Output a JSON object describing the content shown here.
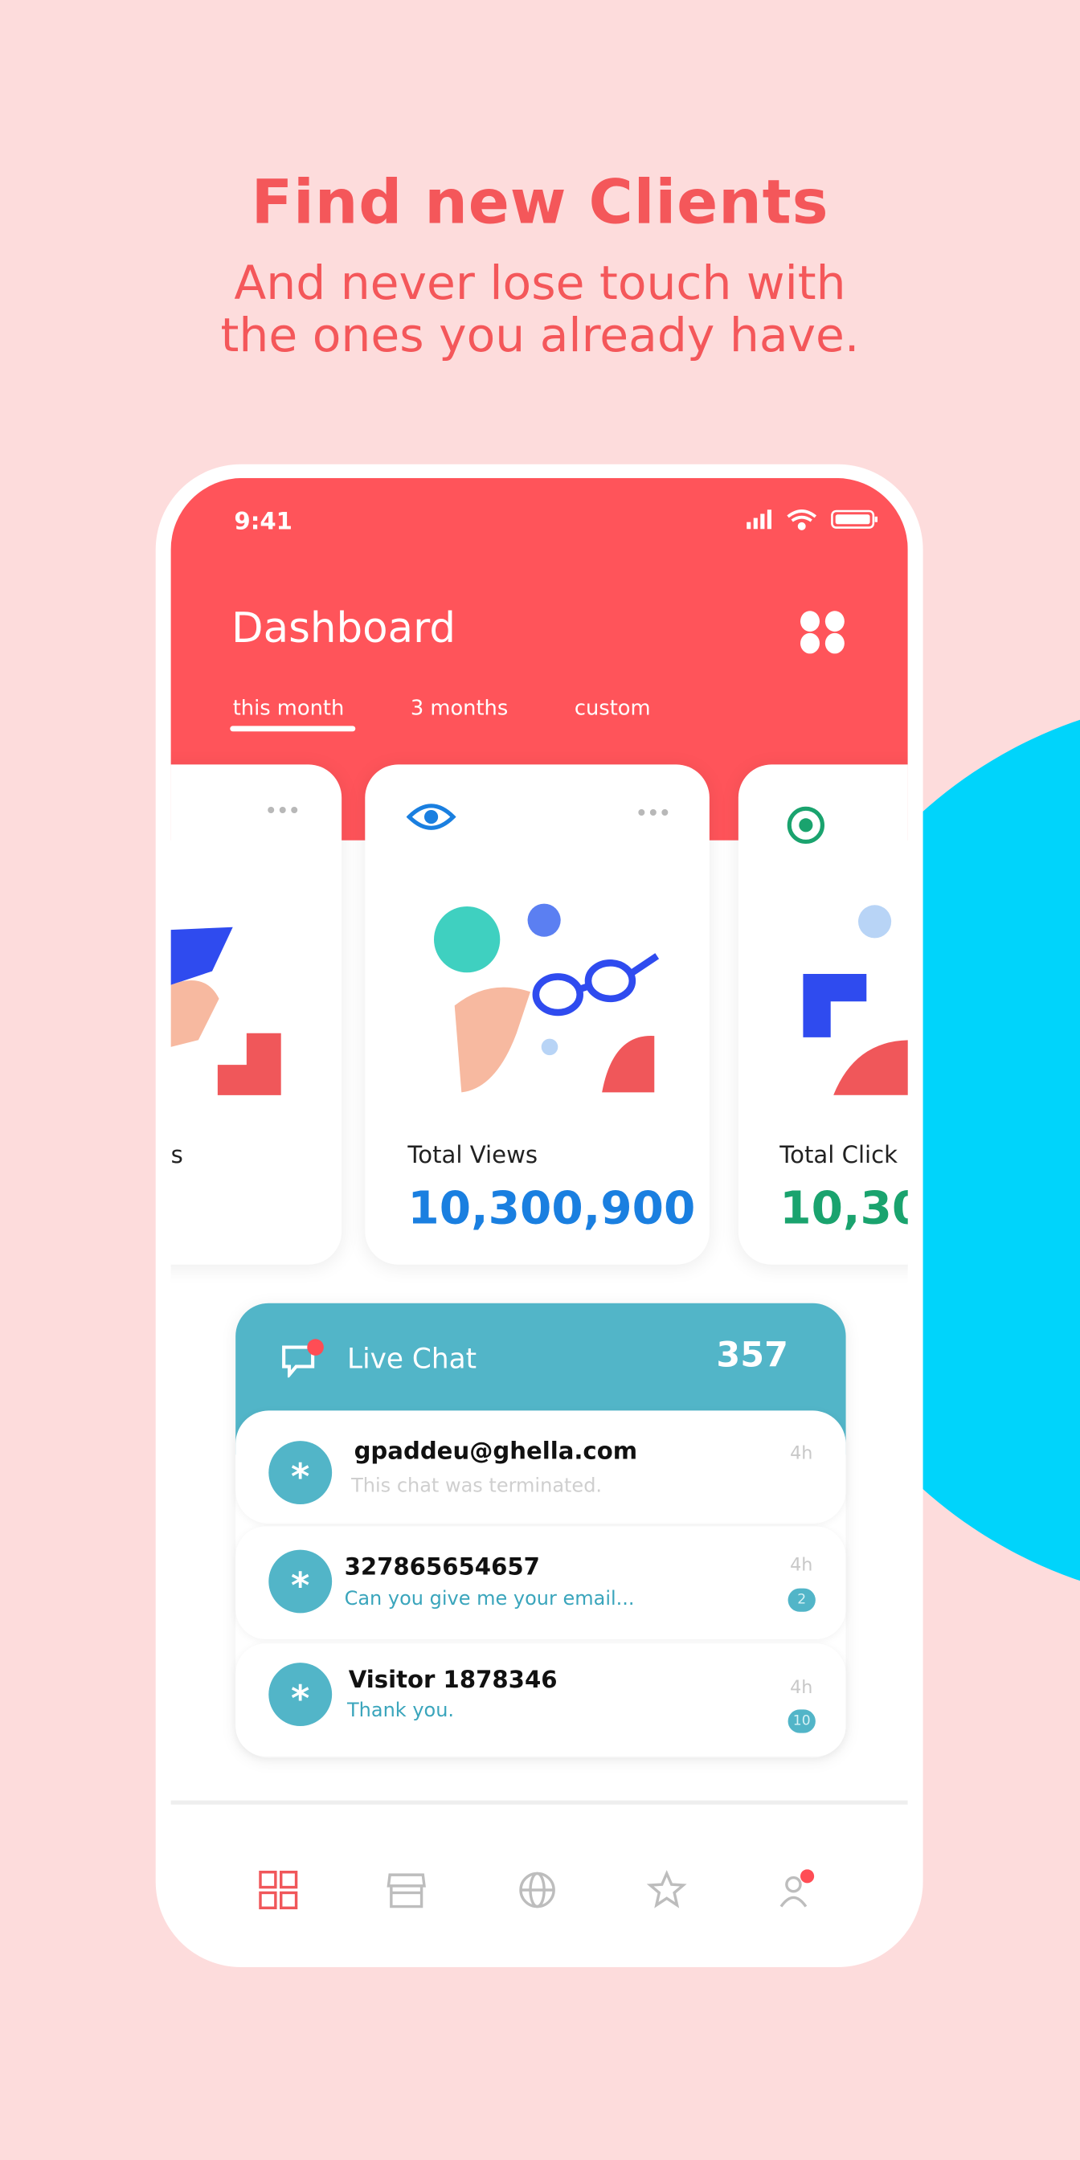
{
  "hero": {
    "title": "Find new Clients",
    "subtitle_line1": "And never lose touch with",
    "subtitle_line2": "the ones you already have."
  },
  "colors": {
    "background": "#fddcdc",
    "accent_red": "#ff545a",
    "teal": "#52b5c8",
    "cyan_blob": "#00d4fb",
    "views_blue": "#1a7fe0",
    "clicks_green": "#1aa36e"
  },
  "status_bar": {
    "time": "9:41",
    "icons": [
      "signal-icon",
      "wifi-icon",
      "battery-icon"
    ]
  },
  "header": {
    "title": "Dashboard",
    "menu_icon": "grid-dots-icon",
    "tabs": [
      {
        "label": "this month",
        "active": true
      },
      {
        "label": "3 months",
        "active": false
      },
      {
        "label": "custom",
        "active": false
      }
    ]
  },
  "cards": [
    {
      "label": "s",
      "icon": "none"
    },
    {
      "label": "Total Views",
      "value": "10,300,900",
      "icon": "eye-icon"
    },
    {
      "label": "Total Click",
      "value": "10,30",
      "icon": "target-icon"
    }
  ],
  "live_chat": {
    "title": "Live Chat",
    "count": "357",
    "chats": [
      {
        "name": "gpaddeu@ghella.com",
        "message": "This chat was terminated.",
        "time": "4h",
        "unread": null
      },
      {
        "name": "327865654657",
        "message": "Can you give me your email...",
        "time": "4h",
        "unread": "2"
      },
      {
        "name": "Visitor 1878346",
        "message": "Thank you.",
        "time": "4h",
        "unread": "10"
      }
    ]
  },
  "bottom_nav": [
    {
      "icon": "dashboard-grid-icon",
      "active": true
    },
    {
      "icon": "store-icon"
    },
    {
      "icon": "globe-icon"
    },
    {
      "icon": "star-icon"
    },
    {
      "icon": "users-icon",
      "notification": true
    }
  ]
}
